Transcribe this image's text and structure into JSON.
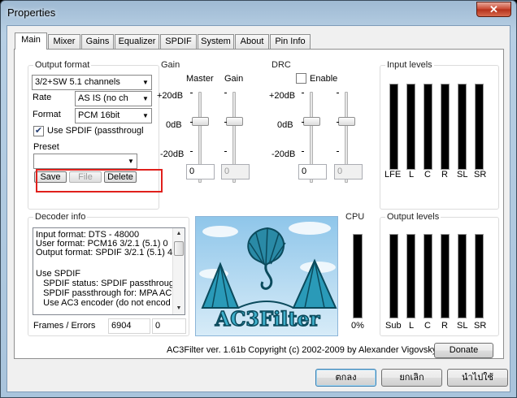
{
  "window": {
    "title": "Properties",
    "close_label": "✕"
  },
  "tabs": [
    "Main",
    "Mixer",
    "Gains",
    "Equalizer",
    "SPDIF",
    "System",
    "About",
    "Pin Info"
  ],
  "output_format": {
    "group_title": "Output format",
    "format_value": "3/2+SW 5.1 channels",
    "rate_label": "Rate",
    "rate_value": "AS IS (no ch",
    "format_label": "Format",
    "format_select_value": "PCM 16bit",
    "spdif_checkbox_label": "Use SPDIF (passthrougl",
    "spdif_checked": true,
    "preset_label": "Preset",
    "preset_value": "",
    "save_label": "Save",
    "file_label": "File",
    "delete_label": "Delete"
  },
  "gain": {
    "group_title": "Gain",
    "master_label": "Master",
    "gain_label": "Gain",
    "scale": [
      "+20dB",
      "0dB",
      "-20dB"
    ],
    "master_value": "0",
    "gain_value": "0"
  },
  "drc": {
    "group_title": "DRC",
    "enable_label": "Enable",
    "enabled": false,
    "scale": [
      "+20dB",
      "0dB",
      "-20dB"
    ],
    "value1": "0",
    "value2": "0"
  },
  "input_levels": {
    "group_title": "Input levels",
    "channels": [
      "LFE",
      "L",
      "C",
      "R",
      "SL",
      "SR"
    ]
  },
  "decoder_info": {
    "group_title": "Decoder info",
    "lines": [
      "Input format: DTS - 48000",
      "User format: PCM16 3/2.1 (5.1) 0",
      "Output format: SPDIF 3/2.1 (5.1) 4",
      "",
      "Use SPDIF",
      "   SPDIF status: SPDIF passthroug",
      "   SPDIF passthrough for: MPA AC",
      "   Use AC3 encoder (do not encod"
    ],
    "frames_label": "Frames / Errors",
    "frames_value": "6904",
    "errors_value": "0"
  },
  "logo": {
    "text": "AC3Filter"
  },
  "cpu": {
    "group_title": "CPU",
    "value": "0%"
  },
  "output_levels": {
    "group_title": "Output levels",
    "channels": [
      "Sub",
      "L",
      "C",
      "R",
      "SL",
      "SR"
    ]
  },
  "copyright": "AC3Filter ver. 1.61b Copyright (c) 2002-2009 by Alexander Vigovsky",
  "donate_label": "Donate",
  "dialog_buttons": {
    "ok": "ตกลง",
    "cancel": "ยกเลิก",
    "apply": "นำไปใช้"
  },
  "colors": {
    "highlight": "#e0201c",
    "title_bar": "#b7cfe4"
  }
}
